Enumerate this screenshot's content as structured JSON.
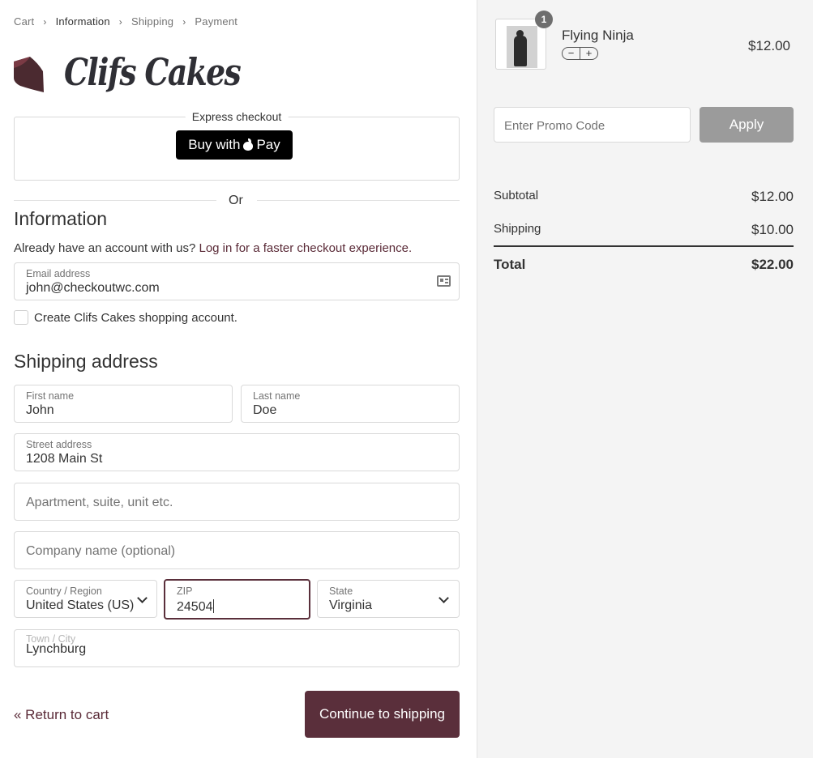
{
  "breadcrumb": {
    "items": [
      "Cart",
      "Information",
      "Shipping",
      "Payment"
    ]
  },
  "logo": {
    "text": "Clifs Cakes"
  },
  "express": {
    "title": "Express checkout",
    "applepay_prefix": "Buy with",
    "applepay_suffix": "Pay"
  },
  "divider": {
    "or": "Or"
  },
  "information": {
    "heading": "Information",
    "account_prompt": "Already have an account with us?",
    "login_link": "Log in for a faster checkout experience.",
    "email": {
      "label": "Email address",
      "value": "john@checkoutwc.com"
    },
    "create_account_label": "Create Clifs Cakes shopping account."
  },
  "shipping": {
    "heading": "Shipping address",
    "first_name": {
      "label": "First name",
      "value": "John"
    },
    "last_name": {
      "label": "Last name",
      "value": "Doe"
    },
    "street": {
      "label": "Street address",
      "value": "1208 Main St"
    },
    "apartment": {
      "placeholder": "Apartment, suite, unit etc."
    },
    "company": {
      "placeholder": "Company name (optional)"
    },
    "country": {
      "label": "Country / Region",
      "value": "United States (US)"
    },
    "zip": {
      "label": "ZIP",
      "value": "24504"
    },
    "state": {
      "label": "State",
      "value": "Virginia"
    },
    "city": {
      "label": "Town / City",
      "value": "Lynchburg"
    }
  },
  "actions": {
    "return_label": "« Return to cart",
    "continue_label": "Continue to shipping"
  },
  "cart": {
    "product": {
      "name": "Flying Ninja",
      "price": "$12.00",
      "quantity": "1",
      "minus": "−",
      "plus": "+"
    },
    "promo": {
      "placeholder": "Enter Promo Code",
      "apply_label": "Apply"
    },
    "summary": {
      "subtotal_label": "Subtotal",
      "subtotal_value": "$12.00",
      "shipping_label": "Shipping",
      "shipping_value": "$10.00",
      "total_label": "Total",
      "total_value": "$22.00"
    }
  },
  "colors": {
    "accent": "#5a2f3b",
    "sidebar_bg": "#f4f4f4",
    "apply_bg": "#9b9b9b"
  }
}
